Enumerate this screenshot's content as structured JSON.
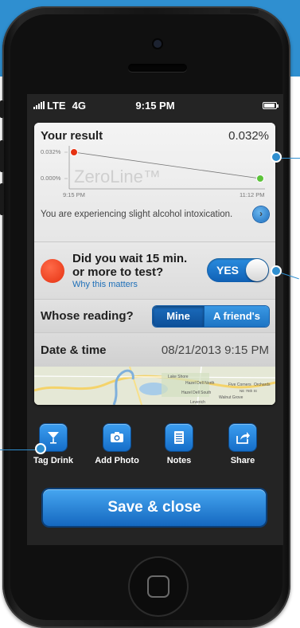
{
  "status_bar": {
    "carrier": "LTE",
    "network": "4G",
    "time": "9:15 PM"
  },
  "result": {
    "title": "Your result",
    "value": "0.032%",
    "message": "You are experiencing slight alcohol intoxication."
  },
  "chart_data": {
    "type": "line",
    "x": [
      "9:15 PM",
      "11:12 PM"
    ],
    "y_ticks": [
      "0.032%",
      "0.000%"
    ],
    "series": [
      {
        "values": [
          0.032,
          0.0
        ]
      }
    ],
    "watermark": "ZeroLine™",
    "ylim": [
      0,
      0.032
    ],
    "point_colors": [
      "#e53212",
      "#5cc33a"
    ],
    "grid": false
  },
  "wait": {
    "question": "Did you wait 15 min. or more to test?",
    "link": "Why this matters",
    "toggle_label": "YES",
    "toggle_on": true
  },
  "whose": {
    "label": "Whose reading?",
    "options": [
      "Mine",
      "A friend's"
    ],
    "selected": "Mine"
  },
  "date_time": {
    "label": "Date & time",
    "value": "08/21/2013 9:15 PM"
  },
  "map": {
    "labels": [
      "Lake Shore",
      "Hazel Dell North",
      "Hazel Dell South",
      "Walnut Grove",
      "Five Corners",
      "Orchards",
      "NE 78th St",
      "Leverich"
    ]
  },
  "actions": [
    {
      "label": "Tag Drink",
      "icon": "cocktail-icon"
    },
    {
      "label": "Add Photo",
      "icon": "camera-icon"
    },
    {
      "label": "Notes",
      "icon": "notes-icon"
    },
    {
      "label": "Share",
      "icon": "share-icon"
    }
  ],
  "save_button": "Save & close",
  "colors": {
    "accent": "#2f8fd0",
    "button_blue": "#1e74c6",
    "red": "#e53212",
    "green": "#5cc33a"
  }
}
